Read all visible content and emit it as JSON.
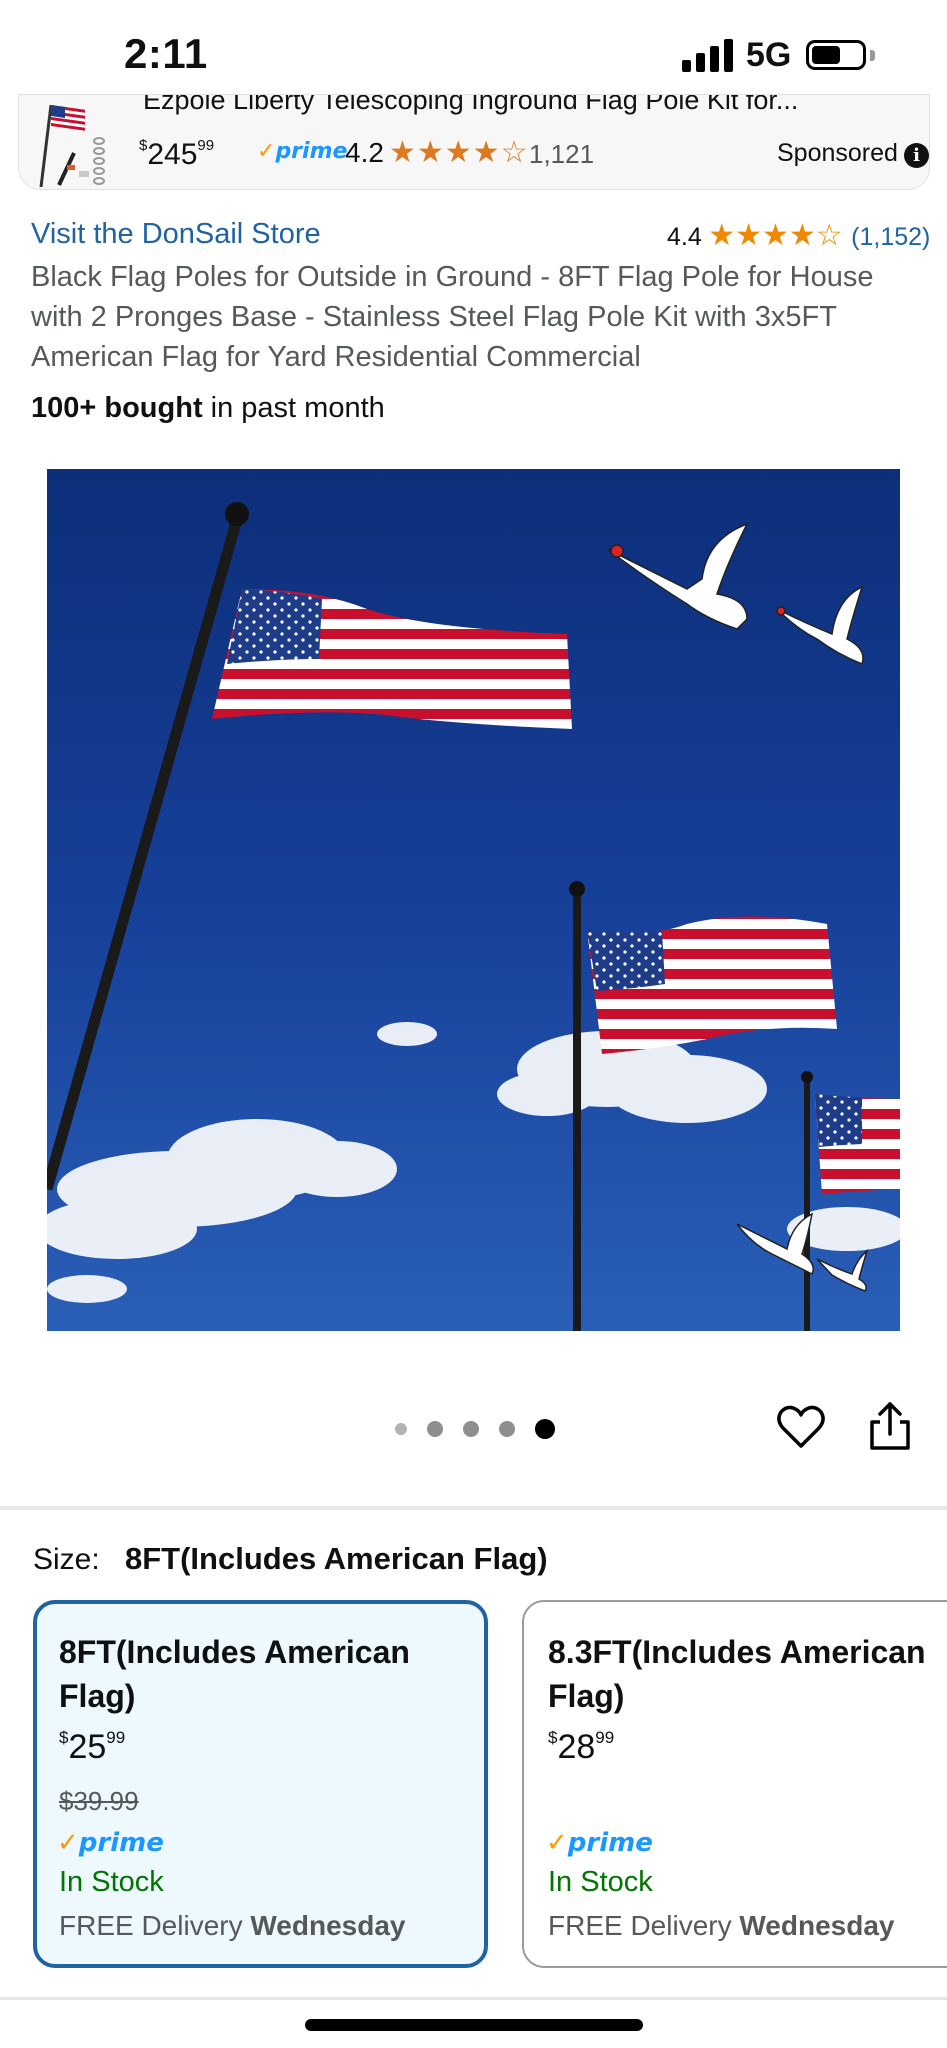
{
  "status_bar": {
    "time": "2:11",
    "network": "5G"
  },
  "sponsored_ad": {
    "title": "Ezpole Liberty Telescoping Inground Flag Pole Kit for...",
    "price_currency": "$",
    "price_whole": "245",
    "price_fraction": "99",
    "prime_check": "✓",
    "prime_label": "prime",
    "rating": "4.2",
    "stars": "★★★★☆",
    "review_count": "1,121",
    "sponsored_label": "Sponsored",
    "info_icon": "info-icon"
  },
  "product": {
    "store_link": "Visit the DonSail Store",
    "rating": "4.4",
    "stars": "★★★★☆",
    "review_count": "(1,152)",
    "title": "Black Flag Poles for Outside in Ground - 8FT Flag Pole for House with 2 Pronges Base - Stainless Steel Flag Pole Kit with 3x5FT American Flag for Yard Residential Commercial",
    "bought_bold": "100+ bought",
    "bought_rest": " in past month"
  },
  "gallery": {
    "image_count": 5,
    "active_index": 4
  },
  "size": {
    "label": "Size:",
    "selected_value": "8FT(Includes American Flag)"
  },
  "options": [
    {
      "name": "8FT(Includes American Flag)",
      "price_currency": "$",
      "price_whole": "25",
      "price_fraction": "99",
      "list_price": "$39.99",
      "prime_check": "✓",
      "prime_label": "prime",
      "stock": "In Stock",
      "delivery_prefix": "FREE Delivery ",
      "delivery_day": "Wednesday",
      "selected": true
    },
    {
      "name": "8.3FT(Includes American Flag)",
      "price_currency": "$",
      "price_whole": "28",
      "price_fraction": "99",
      "prime_check": "✓",
      "prime_label": "prime",
      "stock": "In Stock",
      "delivery_prefix": "FREE Delivery ",
      "delivery_day": "Wednesday",
      "selected": false
    }
  ],
  "colors": {
    "link": "#2162a1",
    "star": "#f08804",
    "in_stock": "#007600",
    "prime": "#1a98ff",
    "selected_border": "#2162a1",
    "selected_bg": "#edf8ff",
    "sky": "#14388a"
  }
}
